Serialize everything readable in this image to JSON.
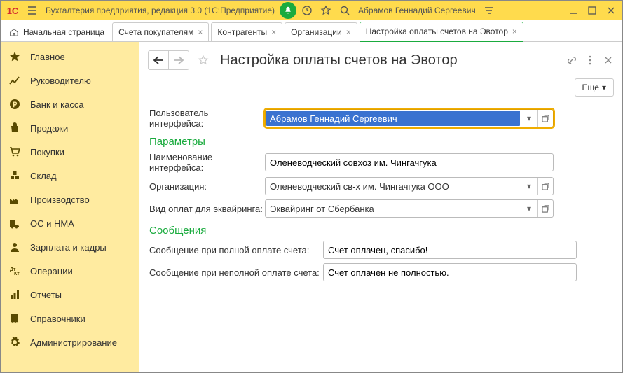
{
  "titlebar": {
    "title": "Бухгалтерия предприятия, редакция 3.0  (1С:Предприятие)",
    "user": "Абрамов Геннадий Сергеевич"
  },
  "tabs": {
    "home": "Начальная страница",
    "t1": "Счета покупателям",
    "t2": "Контрагенты",
    "t3": "Организации",
    "t4": "Настройка оплаты счетов на Эвотор"
  },
  "sidebar": {
    "items": [
      "Главное",
      "Руководителю",
      "Банк и касса",
      "Продажи",
      "Покупки",
      "Склад",
      "Производство",
      "ОС и НМА",
      "Зарплата и кадры",
      "Операции",
      "Отчеты",
      "Справочники",
      "Администрирование"
    ]
  },
  "page": {
    "title": "Настройка оплаты счетов на Эвотор",
    "more": "Еще"
  },
  "form": {
    "user_label": "Пользователь интерфейса:",
    "user_value": "Абрамов Геннадий Сергеевич",
    "section_params": "Параметры",
    "iface_name_label": "Наименование интерфейса:",
    "iface_name_value": "Оленеводческий совхоз им. Чингачгука",
    "org_label": "Организация:",
    "org_value": "Оленеводческий св-х им. Чингачгука ООО",
    "acq_label": "Вид оплат для эквайринга:",
    "acq_value": "Эквайринг от Сбербанка",
    "section_msgs": "Сообщения",
    "msg_full_label": "Сообщение при полной оплате счета:",
    "msg_full_value": "Счет оплачен, спасибо!",
    "msg_part_label": "Сообщение при неполной оплате счета:",
    "msg_part_value": "Счет оплачен не полностью."
  }
}
